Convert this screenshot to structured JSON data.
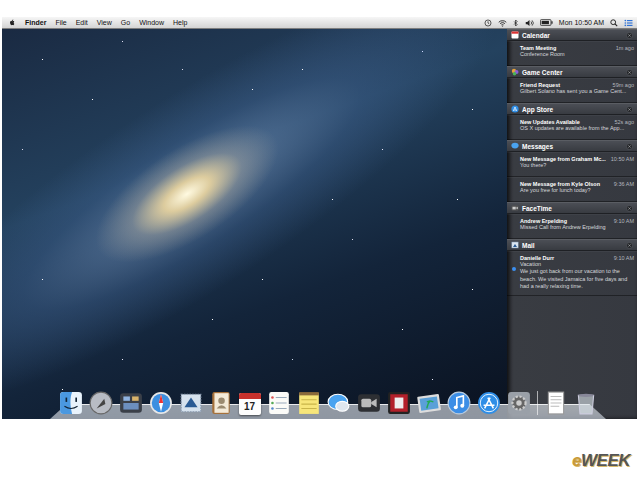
{
  "menu_bar": {
    "app": "Finder",
    "items": [
      "File",
      "Edit",
      "View",
      "Go",
      "Window",
      "Help"
    ],
    "clock": "Mon 10:50 AM"
  },
  "notification_center": {
    "groups": [
      {
        "app": "Calendar",
        "kind": "calendar",
        "items": [
          {
            "title": "Team Meeting",
            "time": "1m ago",
            "body": "Conference Room",
            "unread": false
          }
        ]
      },
      {
        "app": "Game Center",
        "kind": "game-center",
        "items": [
          {
            "title": "Friend Request",
            "time": "59m ago",
            "body": "Gilbert Solano has sent you a Game Cent...",
            "unread": false
          }
        ]
      },
      {
        "app": "App Store",
        "kind": "app-store",
        "items": [
          {
            "title": "New Updates Available",
            "time": "52s ago",
            "body": "OS X updates are available from the App...",
            "unread": false
          }
        ]
      },
      {
        "app": "Messages",
        "kind": "messages",
        "items": [
          {
            "title": "New Message from Graham Mc...",
            "time": "10:50 AM",
            "body": "You there?",
            "unread": false
          },
          {
            "title": "New Message from Kyle Olson",
            "time": "9:36 AM",
            "body": "Are you free for lunch today?",
            "unread": false
          }
        ]
      },
      {
        "app": "FaceTime",
        "kind": "facetime",
        "items": [
          {
            "title": "Andrew Erpelding",
            "time": "9:10 AM",
            "body": "Missed Call from Andrew Erpelding",
            "unread": false
          }
        ]
      },
      {
        "app": "Mail",
        "kind": "mail",
        "items": [
          {
            "title": "Danielle Durr",
            "time": "9:10 AM",
            "subject": "Vacation",
            "body": "We just got back from our vacation to the beach. We visited Jamaica for five days and had a really relaxing time.",
            "unread": true
          }
        ]
      }
    ]
  },
  "dock": {
    "items": [
      {
        "kind": "finder"
      },
      {
        "kind": "launchpad"
      },
      {
        "kind": "mission-control"
      },
      {
        "kind": "safari"
      },
      {
        "kind": "mail"
      },
      {
        "kind": "contacts"
      },
      {
        "kind": "calendar",
        "text": "17"
      },
      {
        "kind": "reminders"
      },
      {
        "kind": "notes"
      },
      {
        "kind": "messages"
      },
      {
        "kind": "facetime"
      },
      {
        "kind": "photo-booth"
      },
      {
        "kind": "iphoto"
      },
      {
        "kind": "itunes"
      },
      {
        "kind": "app-store"
      },
      {
        "kind": "system-preferences"
      },
      {
        "kind": "separator"
      },
      {
        "kind": "preview"
      },
      {
        "kind": "trash"
      }
    ]
  },
  "watermark": "eWEEK"
}
